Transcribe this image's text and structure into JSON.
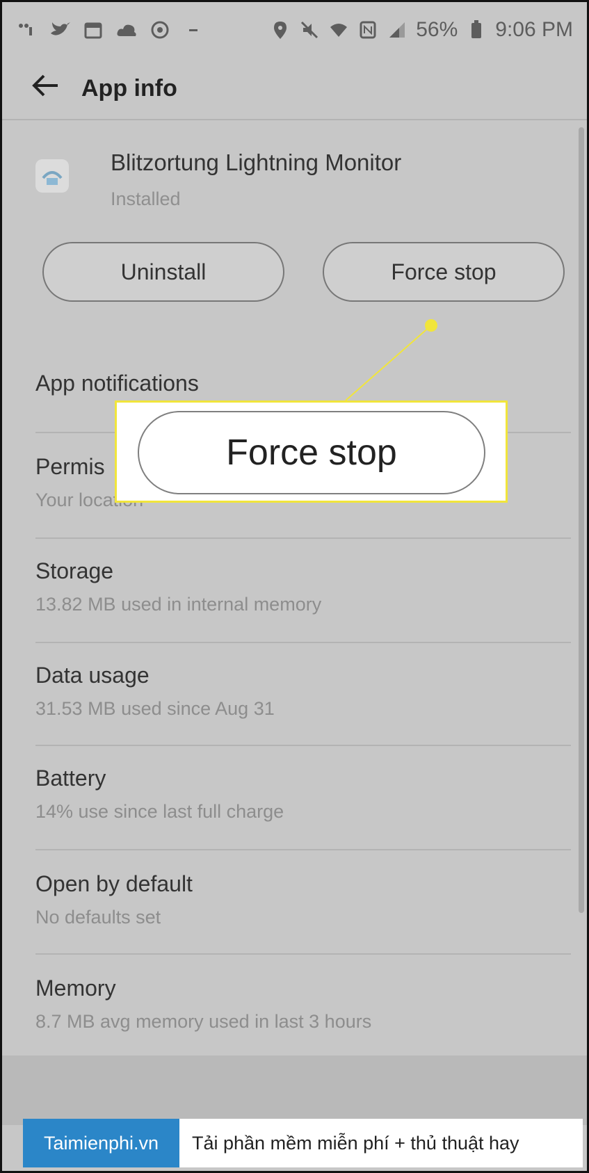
{
  "status_bar": {
    "icons": [
      "signal-dots-icon",
      "twitter-icon",
      "calendar-icon",
      "cloud-icon",
      "target-icon",
      "dash-icon"
    ],
    "right_icons": [
      "location-pin-icon",
      "mute-icon",
      "wifi-icon",
      "nfc-icon",
      "cell-signal-icon"
    ],
    "battery_percent": "56%",
    "time": "9:06 PM"
  },
  "header": {
    "back_icon": "back-arrow-icon",
    "title": "App info"
  },
  "app": {
    "name": "Blitzortung Lightning Monitor",
    "status": "Installed"
  },
  "buttons": {
    "uninstall": "Uninstall",
    "force_stop": "Force stop"
  },
  "list": {
    "notifications": {
      "title": "App notifications"
    },
    "permissions": {
      "title": "Permis",
      "sub": "Your location"
    },
    "storage": {
      "title": "Storage",
      "sub": "13.82 MB used in internal memory"
    },
    "data_usage": {
      "title": "Data usage",
      "sub": "31.53 MB used since Aug 31"
    },
    "battery": {
      "title": "Battery",
      "sub": "14% use since last full charge"
    },
    "open_default": {
      "title": "Open by default",
      "sub": "No defaults set"
    },
    "memory": {
      "title": "Memory",
      "sub": "8.7 MB avg memory used in last 3 hours"
    }
  },
  "callout": {
    "label": "Force stop",
    "border_color": "#f1e53b"
  },
  "watermark": {
    "brand": "Taimienphi.vn",
    "tagline": "Tải phần mềm miễn phí + thủ thuật hay",
    "brand_color": "#2b86c8"
  }
}
